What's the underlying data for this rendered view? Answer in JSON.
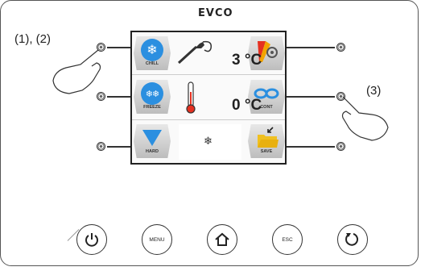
{
  "brand": "EVCO",
  "annotations": {
    "left": "(1), (2)",
    "right": "(3)"
  },
  "tiles": {
    "chill": "CHILL",
    "freeze": "FREEZE",
    "hard": "HARD",
    "cont": "CONT",
    "save": "SAVE"
  },
  "readings": {
    "probe_temp": "3 °C",
    "room_temp": "0 °C"
  },
  "buttons": {
    "menu": "MENU",
    "esc": "ESC"
  }
}
